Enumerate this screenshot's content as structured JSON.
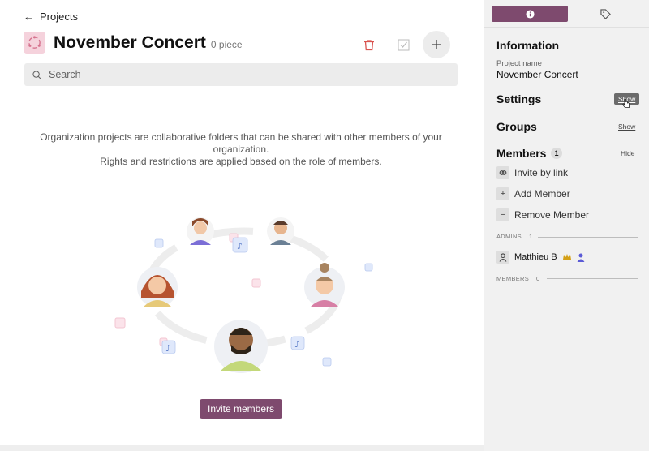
{
  "nav": {
    "back_label": "Projects"
  },
  "project": {
    "title": "November Concert",
    "piece_count": "0 piece"
  },
  "search": {
    "placeholder": "Search",
    "value": ""
  },
  "empty_state": {
    "line1": "Organization projects are collaborative folders that can be shared with other members of your organization.",
    "line2": "Rights and restrictions are applied based on the role of members.",
    "invite_button": "Invite members"
  },
  "panel": {
    "tabs": [
      {
        "icon": "info-icon",
        "active": true
      },
      {
        "icon": "tag-icon",
        "active": false
      }
    ],
    "information": {
      "title": "Information",
      "project_name_label": "Project name",
      "project_name": "November Concert"
    },
    "settings": {
      "title": "Settings",
      "toggle": "Show"
    },
    "groups": {
      "title": "Groups",
      "toggle": "Show"
    },
    "members": {
      "title": "Members",
      "count": "1",
      "toggle": "Hide",
      "actions": [
        {
          "label": "Invite by link",
          "icon": "link-icon"
        },
        {
          "label": "Add Member",
          "icon": "plus-icon"
        },
        {
          "label": "Remove Member",
          "icon": "minus-icon"
        }
      ],
      "admins_label": "ADMINS",
      "admins_count": "1",
      "admins": [
        {
          "name": "Matthieu B",
          "badges": [
            "crown-icon",
            "person-icon"
          ]
        }
      ],
      "members_label": "MEMBERS",
      "members_count": "0"
    }
  },
  "colors": {
    "accent": "#7e4a6e",
    "project_icon_bg": "#f5d2dc",
    "trash": "#d9534f",
    "crown": "#d4a017",
    "person_badge": "#5b5bd6"
  }
}
